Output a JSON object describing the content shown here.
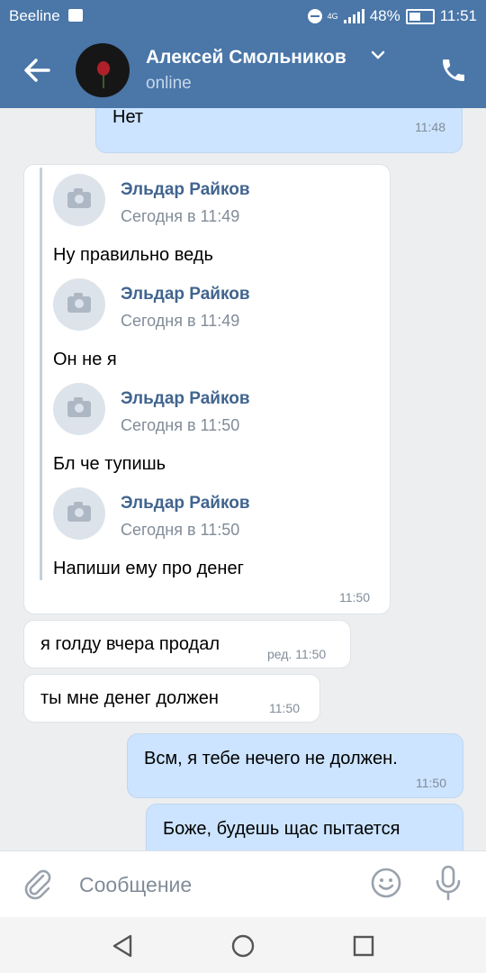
{
  "status_bar": {
    "carrier": "Beeline",
    "network": "4G",
    "battery": "48%",
    "time": "11:51"
  },
  "header": {
    "back_icon": "arrow-left-icon",
    "contact_name": "Алексей Смольников",
    "contact_status": "online",
    "call_icon": "phone-icon"
  },
  "messages": [
    {
      "dir": "out",
      "text": "Нет",
      "time": "11:48"
    },
    {
      "dir": "in",
      "time": "11:50",
      "forwarded": [
        {
          "author": "Эльдар Райков",
          "date": "Сегодня в 11:49",
          "text": "Ну правильно ведь"
        },
        {
          "author": "Эльдар Райков",
          "date": "Сегодня в 11:49",
          "text": "Он не я"
        },
        {
          "author": "Эльдар Райков",
          "date": "Сегодня в 11:50",
          "text": "Бл че тупишь"
        },
        {
          "author": "Эльдар Райков",
          "date": "Сегодня в 11:50",
          "text": "Напиши ему про денег"
        }
      ]
    },
    {
      "dir": "in",
      "text": "я голду вчера продал",
      "time": "ред. 11:50"
    },
    {
      "dir": "in",
      "text": "ты мне денег должен",
      "time": "11:50"
    },
    {
      "dir": "out",
      "text": "Всм, я тебе нечего не должен.",
      "time": "11:50"
    },
    {
      "dir": "out",
      "text": "Боже, будешь щас пытается",
      "time": ""
    }
  ],
  "composer": {
    "attach_icon": "paperclip-icon",
    "placeholder": "Сообщение",
    "emoji_icon": "smile-icon",
    "voice_icon": "microphone-icon"
  },
  "colors": {
    "accent": "#4a76a8",
    "outgoing_bubble": "#cce4ff",
    "incoming_bubble": "#ffffff",
    "chat_background": "#edeef0",
    "forward_author": "#41648f"
  }
}
